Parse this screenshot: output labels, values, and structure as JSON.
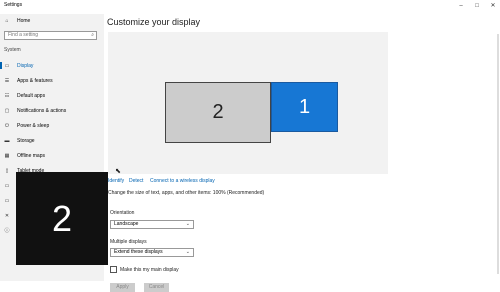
{
  "window": {
    "title": "Settings",
    "minimize": "–",
    "maximize": "□",
    "close": "✕"
  },
  "sidebar": {
    "home": "Home",
    "search_placeholder": "Find a setting",
    "section": "System",
    "items": [
      {
        "label": "Display",
        "icon": "monitor-icon",
        "active": true
      },
      {
        "label": "Apps & features",
        "icon": "apps-icon"
      },
      {
        "label": "Default apps",
        "icon": "default-apps-icon"
      },
      {
        "label": "Notifications & actions",
        "icon": "notifications-icon"
      },
      {
        "label": "Power & sleep",
        "icon": "power-icon"
      },
      {
        "label": "Storage",
        "icon": "storage-icon"
      },
      {
        "label": "Offline maps",
        "icon": "maps-icon"
      },
      {
        "label": "Tablet mode",
        "icon": "tablet-icon"
      }
    ]
  },
  "main": {
    "heading": "Customize your display",
    "monitors": {
      "primary": "1",
      "secondary": "2"
    },
    "links": {
      "identify": "Identify",
      "detect": "Detect",
      "wireless": "Connect to a wireless display"
    },
    "scale_text": "Change the size of text, apps, and other items: 100% (Recommended)",
    "orientation_label": "Orientation",
    "orientation_value": "Landscape",
    "multiple_label": "Multiple displays",
    "multiple_value": "Extend these displays",
    "main_display_label": "Make this my main display",
    "apply": "Apply",
    "cancel": "Cancel"
  },
  "identify_overlay": "2",
  "colors": {
    "accent": "#0063b1",
    "monitor_primary": "#1777d4",
    "monitor_secondary": "#cccccc"
  }
}
